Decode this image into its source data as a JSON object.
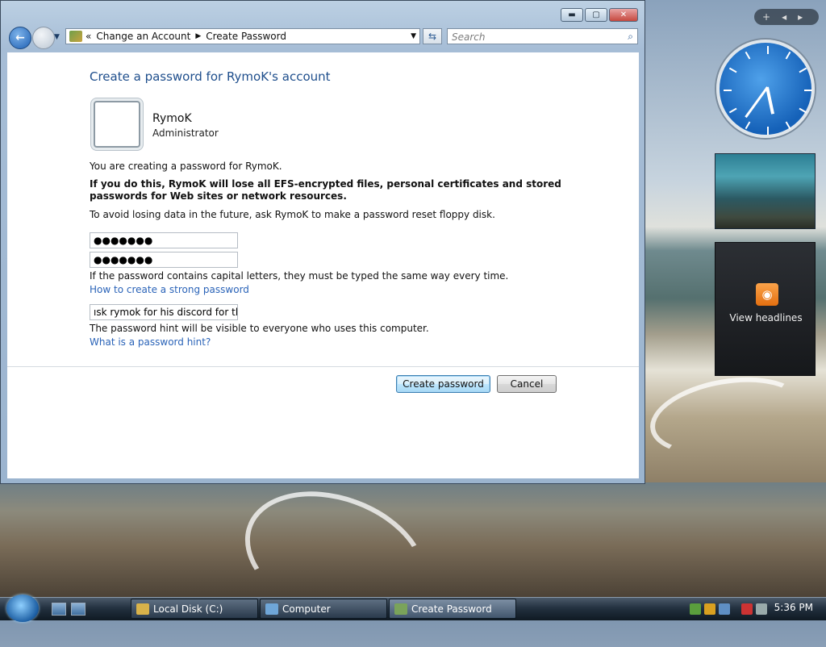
{
  "address_bar": {
    "chevron": "«",
    "crumbs": [
      "Change an Account",
      "Create Password"
    ]
  },
  "search": {
    "placeholder": "Search"
  },
  "window_controls": {
    "minimize": "▬",
    "maximize": "▢",
    "close": "✕"
  },
  "page": {
    "title": "Create a password for RymoK's account",
    "user_name": "RymoK",
    "user_role": "Administrator",
    "line1": "You are creating a password for RymoK.",
    "warning": "If you do this, RymoK will lose all EFS-encrypted files, personal certificates and stored passwords for Web sites or network resources.",
    "line3": "To avoid losing data in the future, ask RymoK to make a password reset floppy disk.",
    "password_value": "●●●●●●●",
    "confirm_value": "●●●●●●●",
    "caps_note": "If the password contains capital letters, they must be typed the same way every time.",
    "strong_link": "How to create a strong password",
    "hint_value": "ısk rymok for his discord for thep",
    "hint_note": "The password hint will be visible to everyone who uses this computer.",
    "hint_link": "What is a password hint?",
    "create_button": "Create password",
    "cancel_button": "Cancel"
  },
  "sidebar": {
    "controls": [
      "+",
      "◂",
      "▸"
    ],
    "clock_time": "5:36",
    "feeds_label": "View headlines"
  },
  "taskbar": {
    "tasks": [
      {
        "label": "Local Disk (C:)",
        "color": "#d8b24a"
      },
      {
        "label": "Computer",
        "color": "#6fa6d8"
      },
      {
        "label": "Create Password",
        "color": "#7aa35a"
      }
    ],
    "time": "5:36 PM"
  }
}
